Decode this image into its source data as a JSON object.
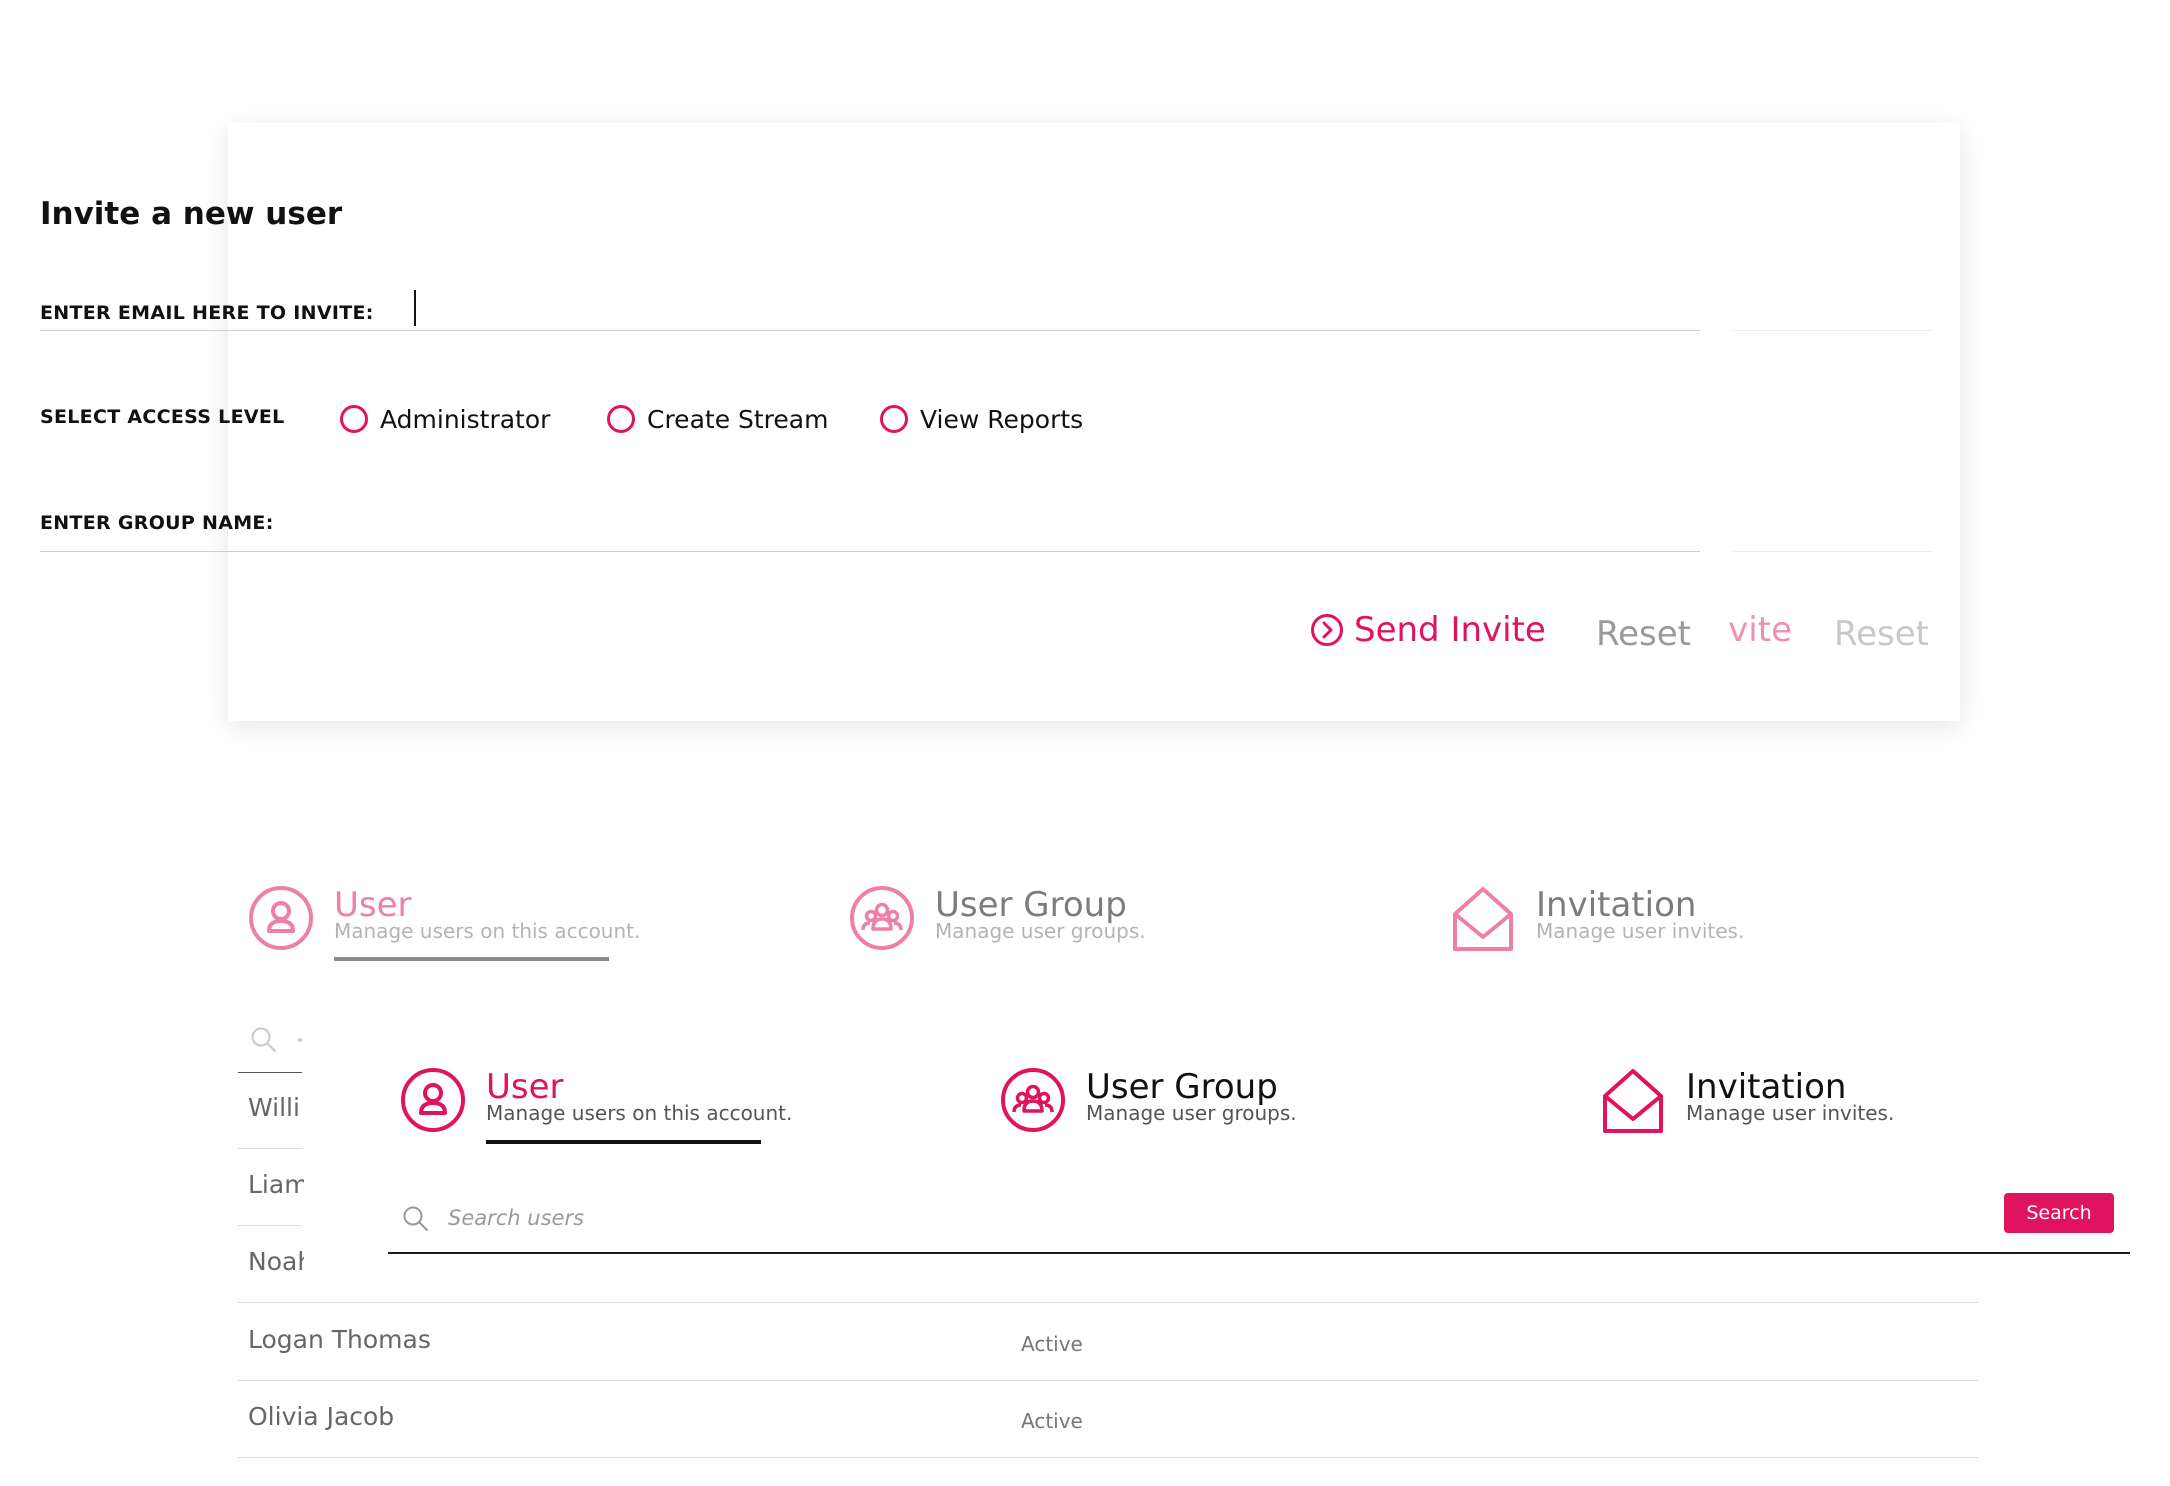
{
  "invite": {
    "title": "Invite a new user",
    "email_label": "ENTER EMAIL HERE TO INVITE:",
    "email_value": "",
    "access_label": "SELECT ACCESS LEVEL",
    "access_options": [
      "Administrator",
      "Create Stream",
      "View Reports"
    ],
    "group_label": "ENTER GROUP NAME:",
    "group_value": "",
    "send_label": "Send Invite",
    "reset_label": "Reset",
    "ghost_send_fragment": "vite",
    "ghost_reset_label": "Reset"
  },
  "tabs": [
    {
      "title": "User",
      "description": "Manage users on this account.",
      "icon": "user-circle-icon"
    },
    {
      "title": "User Group",
      "description": "Manage user groups.",
      "icon": "user-group-icon"
    },
    {
      "title": "Invitation",
      "description": "Manage user invites.",
      "icon": "envelope-open-icon"
    }
  ],
  "search": {
    "placeholder": "Search users",
    "button_label": "Search"
  },
  "users": [
    {
      "name": "Willi"
    },
    {
      "name": "Liam"
    },
    {
      "name": "Noah"
    },
    {
      "name": "Logan Thomas",
      "status": "Active"
    },
    {
      "name": "Olivia Jacob",
      "status": "Active"
    }
  ],
  "colors": {
    "accent": "#e0135e",
    "accent_faded": "#ef7fa9",
    "text": "#111111",
    "muted": "#9a9a9a"
  }
}
